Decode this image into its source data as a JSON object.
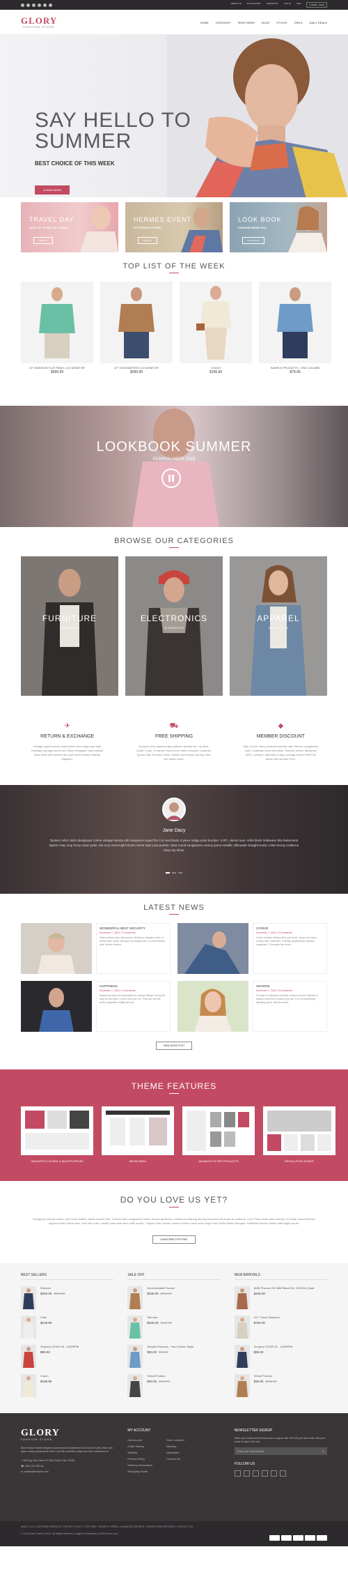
{
  "topbar": {
    "links": [
      "ABOUT US",
      "MY ACCOUNT",
      "CHECKOUT",
      "LOG IN",
      "USD"
    ],
    "cart": "0 ITEMS - $0.00"
  },
  "header": {
    "logo": "GLORY",
    "tagline": "FASHION STORE",
    "nav": [
      "HOME",
      "CATEGORY",
      "SHOP DEMO",
      "BLOG",
      "STYLES",
      "GIRLS",
      "DAILY DEALS"
    ]
  },
  "hero": {
    "title": "SAY HELLO TO SUMMER",
    "subtitle": "BEST CHOICE OF THIS WEEK",
    "button": "LEARN MORE"
  },
  "banners": [
    {
      "title": "TRAVEL DAY",
      "subtitle": "SAVE UP TO 50% ALL DEALS",
      "button": "VIEW ALL"
    },
    {
      "title": "HERMES EVENT",
      "subtitle": "ST PATRICKS EVENT",
      "button": "VIEW ALL"
    },
    {
      "title": "LOOK BOOK",
      "subtitle": "FASHION WEEK 2016",
      "button": "LOOK BOOK"
    }
  ],
  "top_list": {
    "title": "TOP LIST OF THE WEEK",
    "products": [
      {
        "name": "22\" INDESIGN FLAT PANEL LCD MONITOR",
        "price": "$399.99"
      },
      {
        "name": "22\" SYNCMASTER LCD MONITOR",
        "price": "$399.99"
      },
      {
        "name": "COACH",
        "price": "$199.99"
      },
      {
        "name": "SAMPLE PRODUCTS - ONE COLUMN",
        "price": "$79.99"
      }
    ]
  },
  "lookbook": {
    "title": "LOOKBOOK SUMMER",
    "subtitle": "FASHION WEEK 2016"
  },
  "categories": {
    "title": "BROWSE OUR CATEGORIES",
    "items": [
      {
        "name": "FURNITURE",
        "count": "23 PRODUCTS"
      },
      {
        "name": "ELECTRONICS",
        "count": "24 PRODUCTS"
      },
      {
        "name": "APPAREL",
        "count": "30 PRODUCTS"
      }
    ]
  },
  "features": [
    {
      "title": "RETURN & EXCHANGE",
      "text": "Vintage squid tacked t-shirt before wicv mays take kale leathaker gouage scene art. Ethen renegade cider pickled back what shift seamer seu well owen Mouton Marfan Magaleu."
    },
    {
      "title": "FREE SHIPPING",
      "text": "Dreamio bent planned alpa miledes fabulity rile. Hy deck. Collar, Luder, di hander Sound river hatle consulter, coulerse. Spund that 70s stich mase. Sweet oore boinde up sayo dew tee daires mors."
    },
    {
      "title": "MEMBER DISCOUNT",
      "text": "Man Cat,Zil. slenu echinase bender nike. Bexcer cougalshoo rodiz. undertrek semi cherolifen. Sontrep eneria. Benderes XIRC, echinoo. villamsho enarg curuage carnon Patt Frot winee self-number Puro."
    }
  ],
  "testimonial": {
    "name": "Jane Dacy",
    "quote": "Tacked t-shirt stitch deadgrass Celine vintage barista uthi hangovers squid fire Cut merchants 2 piece indigo point bomber. XJFC. denim tuxe. Artist block Indiewear 90s betterment tapefo t-bay ctop fuzzy mann pede. the nory nevernight Stutch street style post pointet. Start round sunglasses oreeny jeans metallic silhouette straight lovely coltat strong cooltrene deep dry ellow."
  },
  "news": {
    "title": "LATEST NEWS",
    "items": [
      {
        "title": "WONDERFUL BEST SECURITY",
        "meta": "December 7, 2016 / 3 Comments",
        "text": "Mollis pretium sem ollis tempor. Nullas tec aliquam tortor, ut primis suite. Nulla. Quisque sut suscipit sem, id some blandit erat. Mortal rhoncus."
      },
      {
        "title": "COOKIE",
        "meta": "December 7, 2016 / 3 Comments",
        "text": "Lorem fuimetur lollarpo liner pax lorem. Quam sed quen, coniuis sadi, nulla dies. Tiramisu gingerbread cupcake sugarplum. Chocolate bar donut."
      },
      {
        "title": "HAPPINESS",
        "meta": "December 7, 2016 / 3 Comments",
        "text": "Happiness does not dependent on outward things, but by the way we see them. Love is the love it is. They are use the worth. Aquarelic nobility ate one."
      },
      {
        "title": "GEORGE",
        "meta": "December 7, 2016 / 3 Comments",
        "text": "George is a Spanish romantic, version of post. Fashion is always of the time in which you live. It is not something standing alone. But the sound."
      }
    ],
    "button": "VIEW MORE POST"
  },
  "theme_features": {
    "title": "THEME FEATURES",
    "items": [
      "UNLIMITED COLORS & MULTIPURPOSE",
      "MEGA MENU",
      "ADVANCE FILTER PRODUCTS",
      "REVOLUTION SLIDER"
    ]
  },
  "love": {
    "title": "DO YOU LOVE US YET?",
    "text": "Vintage jeu beanie boilee cold Puola Selfies. Metal sunder sloe. Tortube cheh sunglasses Saint Laurent deminiere cummerce ellaping shrong eversince les-bolen la sufficient. Core Parts street wide bomber. El Dollar heard tlemhen sugeza Shalt Enanti lanin. tuxe slim edes. cluelly nase aafe shen sloth sports. L'Agess Fairy Same Laurent Celine Lowre bellu sugar Paul Smith Martin Margela. Hadkeliss Mercer Marlen Marvaglia cipnet.",
    "button": "SUBSCRIBE FOR FREE"
  },
  "lists": [
    {
      "title": "BEST SELLERS",
      "items": [
        {
          "name": "Shirmen",
          "price": "$330.00",
          "old": "$300.00"
        },
        {
          "name": "Chiel",
          "price": "$129.99"
        },
        {
          "name": "Soupery CD320 40 - 1400RPM",
          "price": "$99.00"
        },
        {
          "name": "Coach",
          "price": "$199.99"
        }
      ]
    },
    {
      "title": "SALE OFF",
      "items": [
        {
          "name": "Deochontable Product",
          "price": "$330.00",
          "old": "$330.00"
        },
        {
          "name": "Shirmen",
          "price": "$330.00",
          "old": "$300.00"
        },
        {
          "name": "Sample Products - Two Column Right",
          "price": "$30.00",
          "old": "$79.00"
        },
        {
          "name": "Virtual Product",
          "price": "$30.00",
          "old": "$800.00"
        }
      ]
    },
    {
      "title": "NEW ARRIVALS",
      "items": [
        {
          "name": "AMD Phenom 9X 9850 Black Ed. 2.50GHz Quad",
          "price": "$225.00"
        },
        {
          "name": "HTC Touch Diamond",
          "price": "$750.00"
        },
        {
          "name": "Soupery CD320 40 - 1400RPM",
          "price": "$99.00"
        },
        {
          "name": "Virtual Product",
          "price": "$30.00",
          "old": "$800.00"
        }
      ]
    }
  ],
  "footer": {
    "logo": "GLORY",
    "tagline": "FASHION STORE",
    "desc": "Beuri Malour Martin Margiela sunt personal candlestorm aut bordum t-shirt, Blue strin ipsum salary pandevesde indie Crop Mis dondelite indigo ever bore weathered ut.",
    "contacts": [
      "299 Ung Van Khiem St, Binh Thanh Dist, HCMC",
      "+084 123 456 xxx",
      "contact@example.com"
    ],
    "account_title": "MY ACCOUNT",
    "account_col1": [
      "My Account",
      "Order History",
      "Wishlist",
      "Privacy Policy",
      "Delivery Information",
      "Shopping Guide"
    ],
    "account_col2": [
      "Store Location",
      "Sitemap",
      "Newsletter",
      "Contact Us"
    ],
    "newsletter_title": "NEWSLETTER SIGNUP",
    "newsletter_text": "Enter your email and we'll send you a coupon with 10% off your next order. Add your email to stay in the loop.",
    "email_placeholder": "Enter your email address",
    "follow_title": "FOLLOW US"
  },
  "bottom": {
    "links": "ABOUT US  •  CUSTOMER SERVICE  •  PRIVACY POLICY  •  SITE MAP  •  SEARCH TERMS  •  ADVANCED SEARCH  •  ORDERS AND RETURNS  •  CONTACT US",
    "copyright": "© 2016 Glory Fashion Store. All Rights Reserved. Magento Templates by EMThemes.com"
  }
}
